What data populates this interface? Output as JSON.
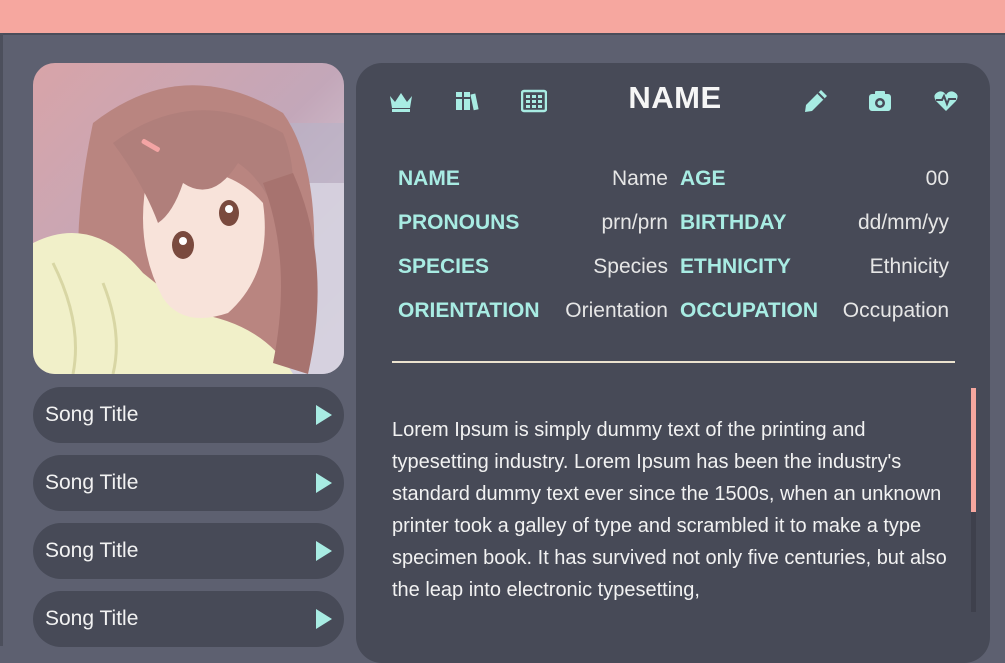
{
  "header": {
    "title": "NAME"
  },
  "toolbar": {
    "left_icons": [
      "crown-icon",
      "books-icon",
      "abacus-icon"
    ],
    "right_icons": [
      "pencil-icon",
      "camera-icon",
      "heartbeat-icon"
    ]
  },
  "fields": {
    "name": {
      "label": "NAME",
      "value": "Name"
    },
    "age": {
      "label": "AGE",
      "value": "00"
    },
    "pronouns": {
      "label": "PRONOUNS",
      "value": "prn/prn"
    },
    "birthday": {
      "label": "BIRTHDAY",
      "value": "dd/mm/yy"
    },
    "species": {
      "label": "SPECIES",
      "value": "Species"
    },
    "ethnicity": {
      "label": "ETHNICITY",
      "value": "Ethnicity"
    },
    "orientation": {
      "label": "ORIENTATION",
      "value": "Orientation"
    },
    "occupation": {
      "label": "OCCUPATION",
      "value": "Occupation"
    }
  },
  "songs": [
    {
      "title": "Song Title"
    },
    {
      "title": "Song Title"
    },
    {
      "title": "Song Title"
    },
    {
      "title": "Song Title"
    }
  ],
  "description": "Lorem Ipsum is simply dummy text of the printing and typesetting industry. Lorem Ipsum has been the industry's standard dummy text ever since the 1500s, when an unknown printer took a galley of type and scrambled it to make a type specimen book. It has survived not only five centuries, but also the leap into electronic typesetting,",
  "colors": {
    "accent": "#a8ece3",
    "topbar": "#f6a79f",
    "background": "#5d6070",
    "panel": "#474a57",
    "divider": "#ece3cf"
  }
}
